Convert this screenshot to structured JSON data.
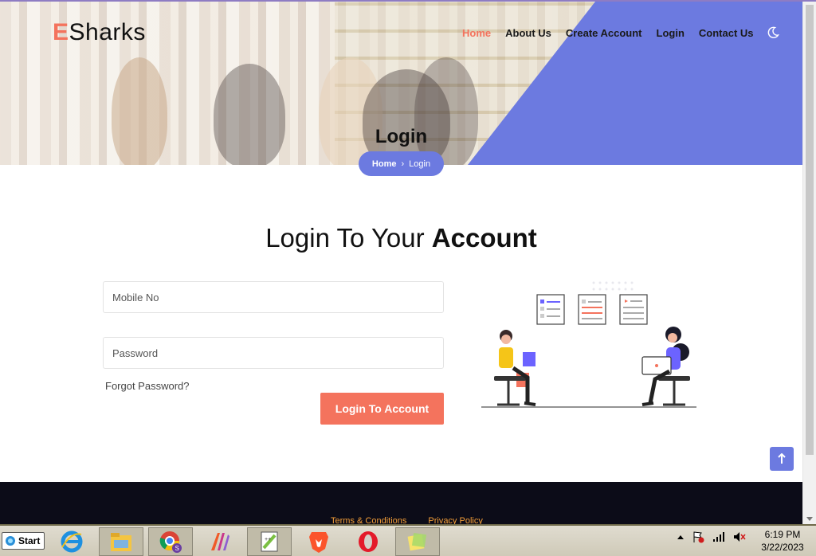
{
  "brand": {
    "logo_letter": "E",
    "logo_rest": "Sharks"
  },
  "nav": {
    "items": [
      {
        "label": "Home",
        "active": true
      },
      {
        "label": "About Us",
        "active": false
      },
      {
        "label": "Create Account",
        "active": false
      },
      {
        "label": "Login",
        "active": false
      },
      {
        "label": "Contact Us",
        "active": false
      }
    ],
    "theme_icon": "moon-icon"
  },
  "hero": {
    "title": "Login",
    "breadcrumb": {
      "home": "Home",
      "separator": "›",
      "current": "Login"
    }
  },
  "main": {
    "title_light": "Login To Your ",
    "title_bold": "Account",
    "mobile_placeholder": "Mobile No",
    "password_placeholder": "Password",
    "forgot": "Forgot Password?",
    "submit": "Login To Account"
  },
  "footer": {
    "links": [
      "Terms & Conditions",
      "Privacy Policy"
    ]
  },
  "taskbar": {
    "start": "Start",
    "apps": [
      "internet-explorer-icon",
      "file-explorer-icon",
      "chrome-icon",
      "pycharm-icon",
      "notepad-plus-plus-icon",
      "brave-icon",
      "opera-icon",
      "sticky-notes-icon"
    ],
    "time": "6:19 PM",
    "date": "3/22/2023"
  },
  "colors": {
    "accent": "#f4735d",
    "purple": "#6c7ae0",
    "footer_bg": "#0c0c18",
    "footer_link": "#f59f38"
  }
}
